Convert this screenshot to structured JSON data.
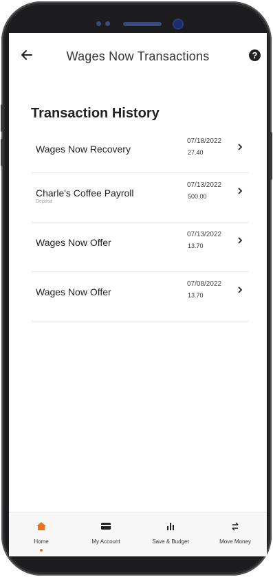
{
  "header": {
    "title": "Wages Now Transactions",
    "help_glyph": "?"
  },
  "section_title": "Transaction History",
  "transactions": [
    {
      "title": "Wages Now Recovery",
      "subtitle": "",
      "date": "07/18/2022",
      "amount": "27.40"
    },
    {
      "title": "Charle's Coffee Payroll",
      "subtitle": "Deposit",
      "date": "07/13/2022",
      "amount": "500.00"
    },
    {
      "title": "Wages Now Offer",
      "subtitle": "",
      "date": "07/13/2022",
      "amount": "13.70"
    },
    {
      "title": "Wages Now Offer",
      "subtitle": "",
      "date": "07/08/2022",
      "amount": "13.70"
    }
  ],
  "nav": {
    "home": "Home",
    "my_account": "My Account",
    "save_budget": "Save & Budget",
    "move_money": "Move Money"
  },
  "colors": {
    "accent": "#e8731c",
    "phone_frame": "#1c1c1e"
  },
  "icons": [
    "back-arrow-icon",
    "help-icon",
    "chevron-right-icon",
    "home-icon",
    "card-icon",
    "bar-chart-icon",
    "transfer-arrows-icon"
  ]
}
